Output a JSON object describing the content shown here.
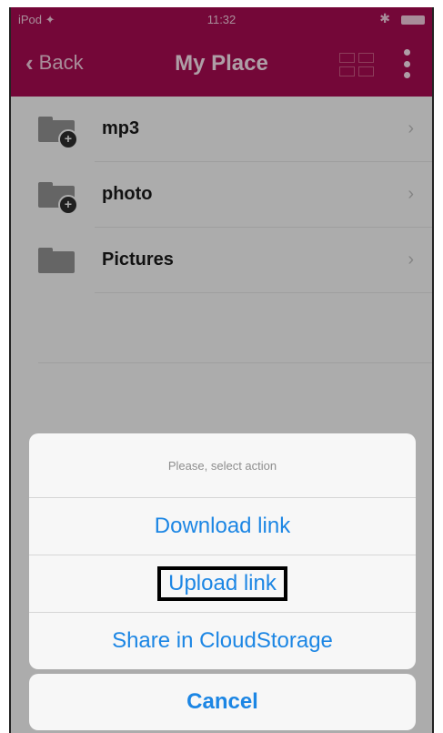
{
  "status_bar": {
    "carrier": "iPod ✦",
    "time": "11:32"
  },
  "nav": {
    "back_label": "Back",
    "title": "My Place"
  },
  "folders": [
    {
      "name": "mp3",
      "has_badge": true
    },
    {
      "name": "photo",
      "has_badge": true
    },
    {
      "name": "Pictures",
      "has_badge": false
    }
  ],
  "action_sheet": {
    "prompt": "Please, select action",
    "actions": [
      "Download link",
      "Upload link",
      "Share in CloudStorage"
    ],
    "cancel_label": "Cancel",
    "highlighted_action": "Upload link"
  },
  "colors": {
    "nav_bar": "#a10b4e",
    "action_text": "#1c86e4"
  },
  "icons": [
    "back-chevron-icon",
    "grid-view-icon",
    "more-vertical-icon",
    "folder-icon",
    "add-badge-icon",
    "chevron-right-icon",
    "battery-icon",
    "bluetooth-icon",
    "wifi-icon"
  ]
}
